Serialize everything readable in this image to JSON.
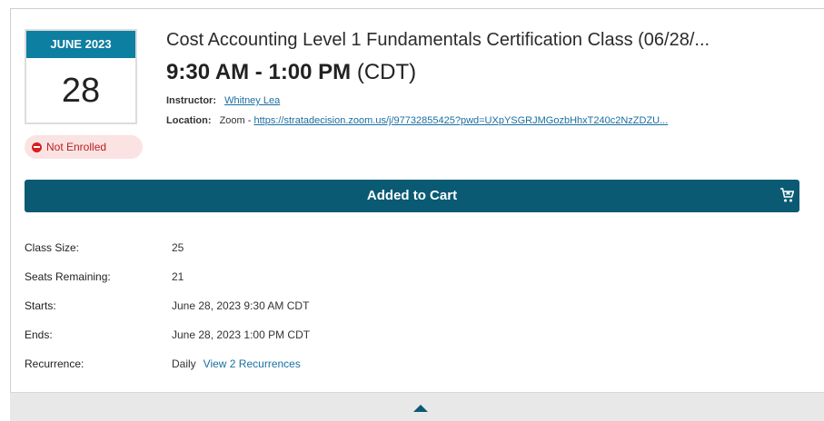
{
  "event": {
    "month_year": "JUNE 2023",
    "day": "28",
    "status": "Not Enrolled",
    "title": "Cost Accounting Level 1 Fundamentals Certification Class (06/28/...",
    "time_range": "9:30 AM - 1:00 PM",
    "timezone": "(CDT)",
    "instructor_label": "Instructor:",
    "instructor_name": "Whitney Lea",
    "location_label": "Location:",
    "location_prefix": "Zoom - ",
    "location_url": "https://stratadecision.zoom.us/j/97732855425?pwd=UXpYSGRJMGozbHhxT240c2NzZDZU..."
  },
  "cart": {
    "label": "Added to Cart",
    "icon": "cart-remove-icon"
  },
  "details": [
    {
      "label": "Class Size:",
      "value": "25"
    },
    {
      "label": "Seats Remaining:",
      "value": "21"
    },
    {
      "label": "Starts:",
      "value": "June 28, 2023 9:30 AM CDT"
    },
    {
      "label": "Ends:",
      "value": "June 28, 2023 1:00 PM CDT"
    },
    {
      "label": "Recurrence:",
      "value": "Daily",
      "link": "View 2 Recurrences"
    }
  ],
  "colors": {
    "date_header": "#0d7fa0",
    "cart_bar": "#0a5a73",
    "badge_bg": "#fbe3e3",
    "badge_text": "#b82020",
    "link": "#1a6fa0"
  },
  "expand": {
    "icon": "chevron-up-icon"
  }
}
